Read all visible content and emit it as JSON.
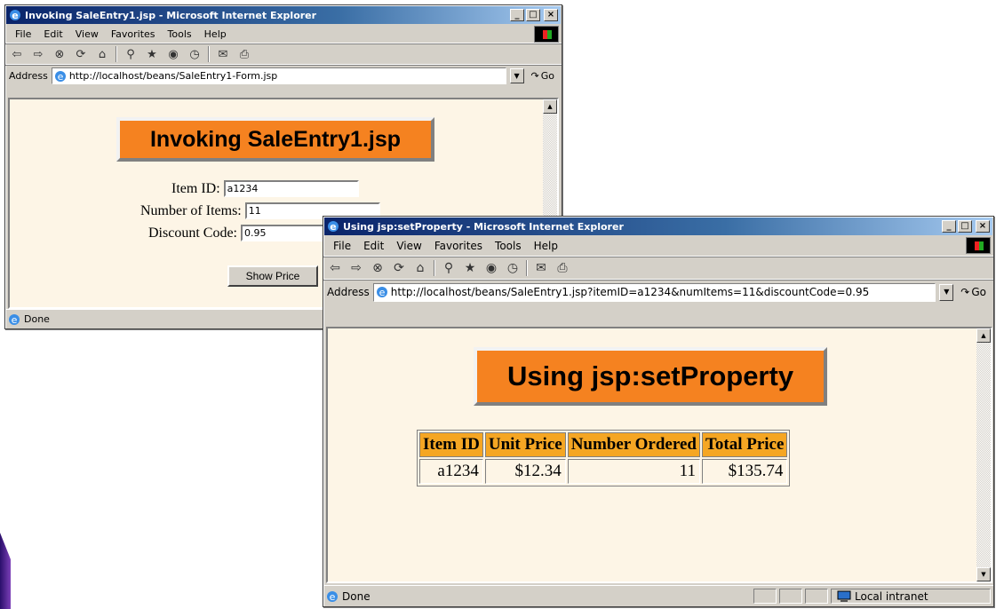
{
  "window1": {
    "title": "Invoking SaleEntry1.jsp - Microsoft Internet Explorer",
    "menu": [
      "File",
      "Edit",
      "View",
      "Favorites",
      "Tools",
      "Help"
    ],
    "address_label": "Address",
    "url": "http://localhost/beans/SaleEntry1-Form.jsp",
    "go_label": "Go",
    "heading": "Invoking SaleEntry1.jsp",
    "form": {
      "item_id_label": "Item ID:",
      "item_id_value": "a1234",
      "num_items_label": "Number of Items:",
      "num_items_value": "11",
      "discount_label": "Discount Code:",
      "discount_value": "0.95",
      "submit_label": "Show Price"
    },
    "status": "Done"
  },
  "window2": {
    "title": "Using jsp:setProperty - Microsoft Internet Explorer",
    "menu": [
      "File",
      "Edit",
      "View",
      "Favorites",
      "Tools",
      "Help"
    ],
    "address_label": "Address",
    "url": "http://localhost/beans/SaleEntry1.jsp?itemID=a1234&numItems=11&discountCode=0.95",
    "go_label": "Go",
    "heading": "Using jsp:setProperty",
    "table": {
      "headers": [
        "Item ID",
        "Unit Price",
        "Number Ordered",
        "Total Price"
      ],
      "row": [
        "a1234",
        "$12.34",
        "11",
        "$135.74"
      ]
    },
    "status": "Done",
    "zone": "Local intranet"
  },
  "colors": {
    "heading_bg": "#f58220",
    "table_header_bg": "#f5a623",
    "page_bg": "#fdf5e6",
    "titlebar_start": "#0a246a"
  }
}
